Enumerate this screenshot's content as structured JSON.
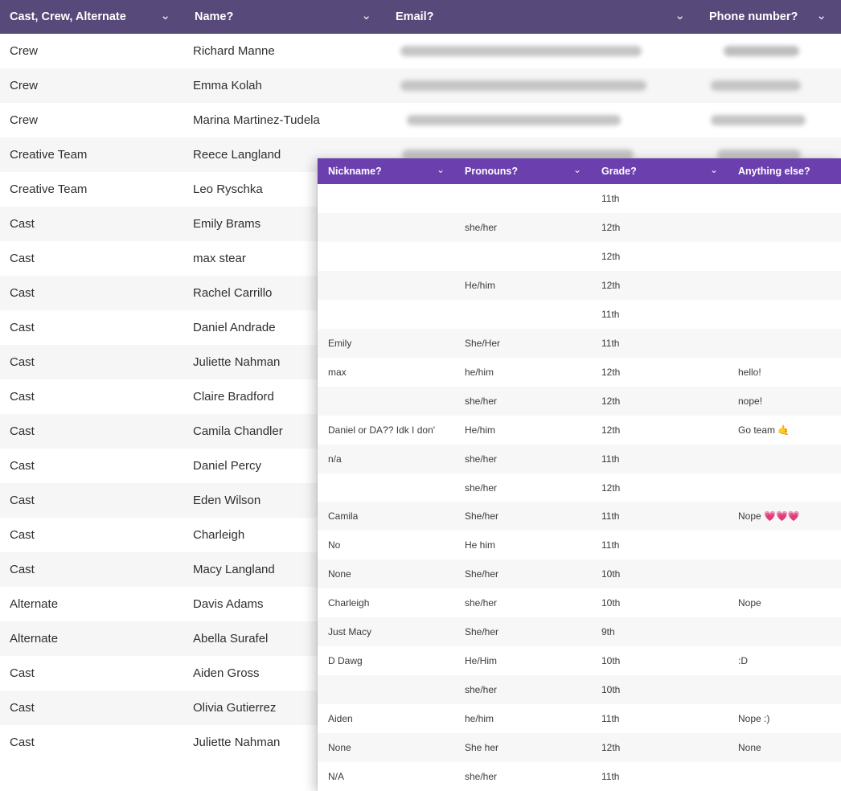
{
  "colors": {
    "main_header_bg": "#574a7a",
    "overlay_header_bg": "#6b3fae"
  },
  "main_table": {
    "columns": [
      "Cast, Crew, Alternate",
      "Name?",
      "Email?",
      "Phone number?"
    ],
    "rows": [
      {
        "role": "Crew",
        "name": "Richard Manne",
        "email_redacted": true,
        "phone_redacted": true
      },
      {
        "role": "Crew",
        "name": "Emma Kolah",
        "email_redacted": true,
        "phone_redacted": true
      },
      {
        "role": "Crew",
        "name": "Marina Martinez-Tudela",
        "email_redacted": true,
        "phone_redacted": true
      },
      {
        "role": "Creative Team",
        "name": "Reece Langland",
        "email_redacted": true,
        "phone_redacted": true
      },
      {
        "role": "Creative Team",
        "name": "Leo Ryschka"
      },
      {
        "role": "Cast",
        "name": "Emily Brams"
      },
      {
        "role": "Cast",
        "name": "max stear"
      },
      {
        "role": "Cast",
        "name": "Rachel Carrillo"
      },
      {
        "role": "Cast",
        "name": "Daniel Andrade"
      },
      {
        "role": "Cast",
        "name": "Juliette Nahman"
      },
      {
        "role": "Cast",
        "name": "Claire Bradford"
      },
      {
        "role": "Cast",
        "name": "Camila Chandler"
      },
      {
        "role": "Cast",
        "name": "Daniel Percy"
      },
      {
        "role": "Cast",
        "name": "Eden Wilson"
      },
      {
        "role": "Cast",
        "name": "Charleigh"
      },
      {
        "role": "Cast",
        "name": "Macy Langland"
      },
      {
        "role": "Alternate",
        "name": "Davis Adams"
      },
      {
        "role": "Alternate",
        "name": "Abella Surafel"
      },
      {
        "role": "Cast",
        "name": "Aiden Gross"
      },
      {
        "role": "Cast",
        "name": "Olivia Gutierrez"
      },
      {
        "role": "Cast",
        "name": "Juliette Nahman"
      }
    ]
  },
  "overlay_table": {
    "columns": [
      "Nickname?",
      "Pronouns?",
      "Grade?",
      "Anything else?"
    ],
    "rows": [
      {
        "nickname": "",
        "pronouns": "",
        "grade": "11th",
        "anything": ""
      },
      {
        "nickname": "",
        "pronouns": "she/her",
        "grade": "12th",
        "anything": ""
      },
      {
        "nickname": "",
        "pronouns": "",
        "grade": "12th",
        "anything": ""
      },
      {
        "nickname": "",
        "pronouns": "He/him",
        "grade": "12th",
        "anything": ""
      },
      {
        "nickname": "",
        "pronouns": "",
        "grade": "11th",
        "anything": ""
      },
      {
        "nickname": "Emily",
        "pronouns": "She/Her",
        "grade": "11th",
        "anything": ""
      },
      {
        "nickname": "max",
        "pronouns": "he/him",
        "grade": "12th",
        "anything": "hello!"
      },
      {
        "nickname": "",
        "pronouns": "she/her",
        "grade": "12th",
        "anything": "nope!"
      },
      {
        "nickname": "Daniel or DA?? Idk I don'",
        "pronouns": "He/him",
        "grade": "12th",
        "anything": "Go team 🤙"
      },
      {
        "nickname": "n/a",
        "pronouns": "she/her",
        "grade": "11th",
        "anything": ""
      },
      {
        "nickname": "",
        "pronouns": "she/her",
        "grade": "12th",
        "anything": ""
      },
      {
        "nickname": "Camila",
        "pronouns": "She/her",
        "grade": "11th",
        "anything": "Nope 💗💗💗"
      },
      {
        "nickname": "No",
        "pronouns": "He him",
        "grade": "11th",
        "anything": ""
      },
      {
        "nickname": "None",
        "pronouns": "She/her",
        "grade": "10th",
        "anything": ""
      },
      {
        "nickname": "Charleigh",
        "pronouns": "she/her",
        "grade": "10th",
        "anything": "Nope"
      },
      {
        "nickname": "Just Macy",
        "pronouns": "She/her",
        "grade": "9th",
        "anything": ""
      },
      {
        "nickname": "D Dawg",
        "pronouns": "He/Him",
        "grade": "10th",
        "anything": ":D"
      },
      {
        "nickname": "",
        "pronouns": "she/her",
        "grade": "10th",
        "anything": ""
      },
      {
        "nickname": "Aiden",
        "pronouns": "he/him",
        "grade": "11th",
        "anything": "Nope :)"
      },
      {
        "nickname": "None",
        "pronouns": "She her",
        "grade": "12th",
        "anything": "None"
      },
      {
        "nickname": "N/A",
        "pronouns": "she/her",
        "grade": "11th",
        "anything": ""
      }
    ]
  }
}
